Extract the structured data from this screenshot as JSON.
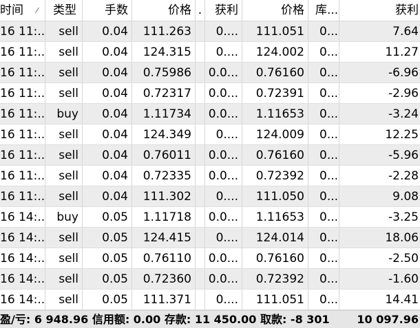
{
  "header": {
    "col_time": "时间",
    "col_type": "类型",
    "col_lots": "手数",
    "col_price": "价格",
    "col_dot": ".",
    "col_tp": "获利",
    "col_price2": "价格",
    "col_swap": "库...",
    "col_profit": "获利"
  },
  "rows": [
    {
      "time": "16 11:...",
      "type": "sell",
      "lots": "0.04",
      "price": "111.263",
      "dot": "",
      "tp": "0....",
      "price2": "111.051",
      "swap": "0...",
      "profit": "7.64"
    },
    {
      "time": "16 11:...",
      "type": "sell",
      "lots": "0.04",
      "price": "124.315",
      "dot": "",
      "tp": "0....",
      "price2": "124.002",
      "swap": "0...",
      "profit": "11.27"
    },
    {
      "time": "16 11:...",
      "type": "sell",
      "lots": "0.04",
      "price": "0.75986",
      "dot": "",
      "tp": "0.0...",
      "price2": "0.76160",
      "swap": "0...",
      "profit": "-6.96"
    },
    {
      "time": "16 11:...",
      "type": "sell",
      "lots": "0.04",
      "price": "0.72317",
      "dot": "",
      "tp": "0.0...",
      "price2": "0.72391",
      "swap": "0...",
      "profit": "-2.96"
    },
    {
      "time": "16 11:...",
      "type": "buy",
      "lots": "0.04",
      "price": "1.11734",
      "dot": "",
      "tp": "0.0...",
      "price2": "1.11653",
      "swap": "0...",
      "profit": "-3.24"
    },
    {
      "time": "16 11:...",
      "type": "sell",
      "lots": "0.04",
      "price": "124.349",
      "dot": "",
      "tp": "0....",
      "price2": "124.009",
      "swap": "0...",
      "profit": "12.25"
    },
    {
      "time": "16 11:...",
      "type": "sell",
      "lots": "0.04",
      "price": "0.76011",
      "dot": "",
      "tp": "0.0...",
      "price2": "0.76160",
      "swap": "0...",
      "profit": "-5.96"
    },
    {
      "time": "16 11:...",
      "type": "sell",
      "lots": "0.04",
      "price": "0.72335",
      "dot": "",
      "tp": "0.0...",
      "price2": "0.72392",
      "swap": "0...",
      "profit": "-2.28"
    },
    {
      "time": "16 11:...",
      "type": "sell",
      "lots": "0.04",
      "price": "111.302",
      "dot": "",
      "tp": "0....",
      "price2": "111.050",
      "swap": "0...",
      "profit": "9.08"
    },
    {
      "time": "16 14:...",
      "type": "buy",
      "lots": "0.05",
      "price": "1.11718",
      "dot": "",
      "tp": "0.0...",
      "price2": "1.11653",
      "swap": "0...",
      "profit": "-3.25"
    },
    {
      "time": "16 14:...",
      "type": "sell",
      "lots": "0.05",
      "price": "124.415",
      "dot": "",
      "tp": "0....",
      "price2": "124.014",
      "swap": "0...",
      "profit": "18.06"
    },
    {
      "time": "16 14:...",
      "type": "sell",
      "lots": "0.05",
      "price": "0.76110",
      "dot": "",
      "tp": "0.0...",
      "price2": "0.76160",
      "swap": "0...",
      "profit": "-2.50"
    },
    {
      "time": "16 14:...",
      "type": "sell",
      "lots": "0.05",
      "price": "0.72360",
      "dot": "",
      "tp": "0.0...",
      "price2": "0.72392",
      "swap": "0...",
      "profit": "-1.60"
    },
    {
      "time": "16 14:...",
      "type": "sell",
      "lots": "0.05",
      "price": "111.371",
      "dot": "",
      "tp": "0....",
      "price2": "111.051",
      "swap": "0...",
      "profit": "14.41"
    }
  ],
  "footer": {
    "summary": "盈/亏: 6 948.96  信用额: 0.00  存款: 11 450.00  取款: -8 301",
    "total": "10 097.96"
  },
  "colors": {
    "row_alt": "#ececec",
    "row_plain": "#ffffff",
    "footer_bg": "#e6e6e6",
    "grid_line": "#d6d6d6"
  }
}
